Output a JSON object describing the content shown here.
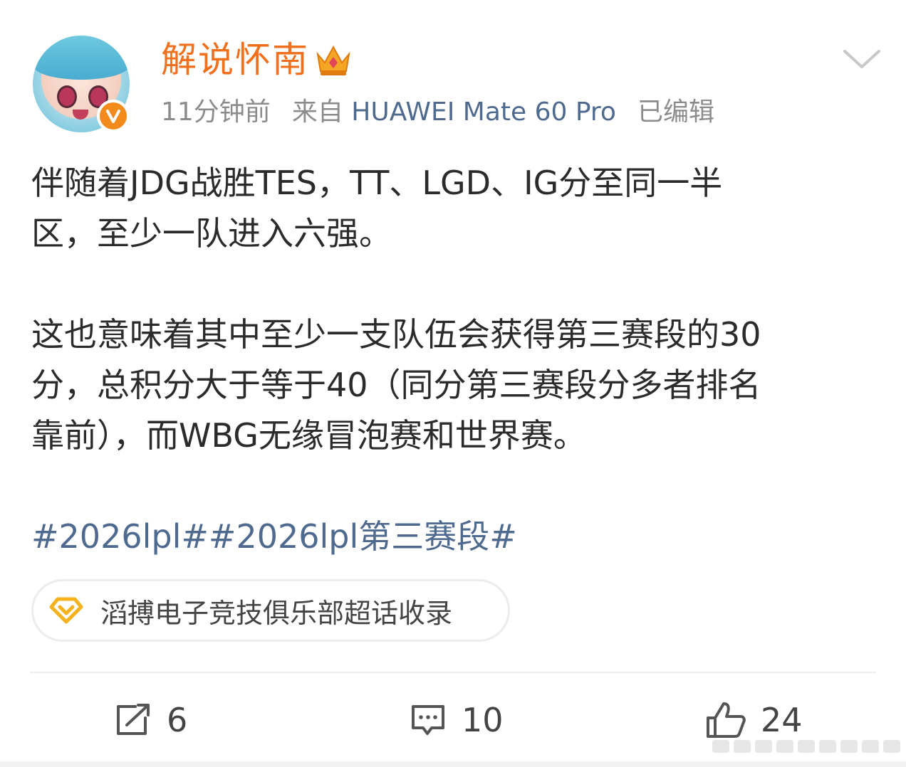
{
  "author": {
    "name": "解说怀南",
    "avatar_icon": "anime-avatar",
    "verified_badge": "verified-v-icon",
    "crown_icon": "crown-icon"
  },
  "meta": {
    "time": "11分钟前",
    "source_prefix": "来自",
    "device": "HUAWEI Mate 60 Pro",
    "edited": "已编辑"
  },
  "post": {
    "paragraph1_line1": "伴随着JDG战胜TES，TT、LGD、IG分至同一半",
    "paragraph1_line2": "区，至少一队进入六强。",
    "paragraph2_line1": "这也意味着其中至少一支队伍会获得第三赛段的30",
    "paragraph2_line2": "分，总积分大于等于40（同分第三赛段分多者排名",
    "paragraph2_line3": "靠前），而WBG无缘冒泡赛和世界赛。",
    "hashtags": "#2026lpl##2026lpl第三赛段#"
  },
  "supertopic": {
    "label": "滔搏电子竞技俱乐部超话收录",
    "icon": "diamond-icon"
  },
  "actions": {
    "repost_count": "6",
    "comment_count": "10",
    "like_count": "24"
  },
  "colors": {
    "username": "#f0701e",
    "link": "#4f6a8f",
    "badge": "#f28a1c"
  }
}
